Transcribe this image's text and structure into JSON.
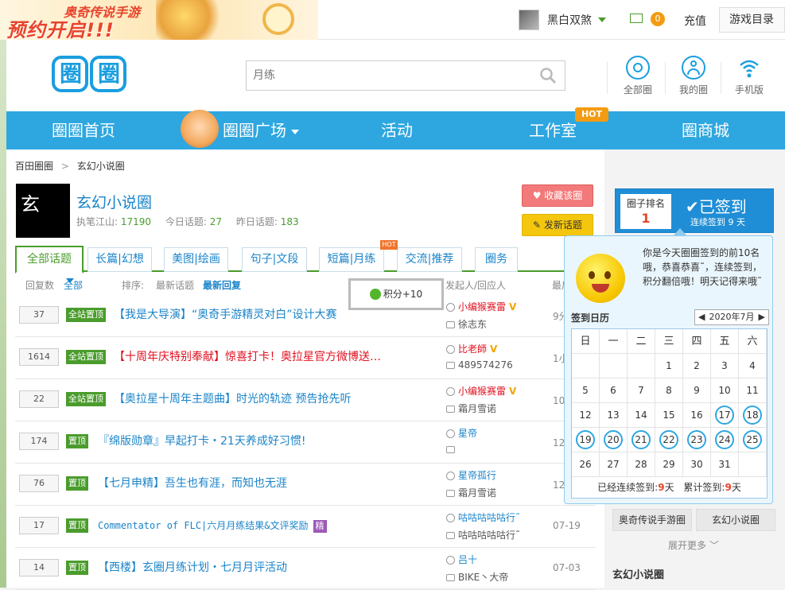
{
  "promo": {
    "line1": "奥奇传说手游",
    "line2": "预约开启!!!"
  },
  "user": {
    "name": "黑白双煞",
    "mail_count": "0",
    "recharge": "充值",
    "game_dir": "游戏目录"
  },
  "logo": {
    "chars": [
      "圈",
      "圈"
    ]
  },
  "search": {
    "placeholder": "月练"
  },
  "header_icons": [
    {
      "label": "全部圈",
      "icon": "all-circles-icon"
    },
    {
      "label": "我的圈",
      "icon": "user-icon"
    },
    {
      "label": "手机版",
      "icon": "wifi-icon"
    }
  ],
  "nav": {
    "home": "圈圈首页",
    "plaza": "圈圈广场",
    "events": "活动",
    "studio": "工作室",
    "studio_badge": "HOT",
    "mall": "圈商城"
  },
  "breadcrumb": {
    "root": "百田圈圈",
    "sep": ">",
    "current": "玄幻小说圈"
  },
  "circle": {
    "logo_char": "玄",
    "name": "玄幻小说圈",
    "master_label": "执笔江山:",
    "master_value": "17190",
    "today_label": "今日话题:",
    "today_value": "27",
    "yesterday_label": "昨日话题:",
    "yesterday_value": "183",
    "fav_button": "收藏该圈",
    "new_button": "发新话题"
  },
  "tabs": [
    {
      "label": "全部话题",
      "active": true
    },
    {
      "label": "长篇|幻想"
    },
    {
      "label": "美图|绘画"
    },
    {
      "label": "句子|文段"
    },
    {
      "label": "短篇|月练",
      "badge": "HOT"
    },
    {
      "label": "交流|推荐"
    },
    {
      "label": "圈务"
    }
  ],
  "filter": {
    "reply_count": "回复数",
    "all": "全部",
    "sort": "排序:",
    "latest_topic": "最新话题",
    "latest_reply": "最新回复",
    "author_col": "发起人/回应人",
    "time_col": "最后"
  },
  "toast": {
    "text": "积分+10"
  },
  "topics": [
    {
      "count": "37",
      "badge": "全站置顶",
      "title": "【我是大导演】“奥奇手游精灵对白”设计大赛",
      "red": false,
      "author": "小编猴赛雷",
      "author_red": true,
      "vip": "V",
      "replier": "徐志东",
      "time": "9分"
    },
    {
      "count": "1614",
      "badge": "全站置顶",
      "title": "【十周年庆特别奉献】惊喜打卡！奥拉星官方微博送…",
      "red": true,
      "author": "比老師",
      "author_red": true,
      "vip": "V",
      "replier": "489574276",
      "time": "1小"
    },
    {
      "count": "22",
      "badge": "全站置顶",
      "title": "【奥拉星十周年主题曲】时光的轨迹 预告抢先听",
      "red": false,
      "author": "小编猴赛雷",
      "author_red": true,
      "vip": "V",
      "replier": "霜月雪诺",
      "time": "10小"
    },
    {
      "count": "174",
      "badge": "置顶",
      "title": "『绵版勋章』早起打卡・21天养成好习惯!",
      "red": false,
      "author": "星帝",
      "author_red": false,
      "vip": "",
      "replier": "",
      "time": "12分"
    },
    {
      "count": "76",
      "badge": "置顶",
      "title": "【七月申精】吾生也有涯，而知也无涯",
      "red": false,
      "author": "星帝孤行",
      "author_red": false,
      "vip": "",
      "replier": "霜月雪诺",
      "time": "12小"
    },
    {
      "count": "17",
      "badge": "置顶",
      "title": "Commentator of FLC|六月月练结果&文评奖励",
      "red": false,
      "tag": "精",
      "author": "咕咕咕咕咕行˜",
      "author_red": false,
      "vip": "",
      "replier": "咕咕咕咕咕行˜",
      "time": "07-19"
    },
    {
      "count": "14",
      "badge": "置顶",
      "title": "【西楼】玄圈月练计划・七月月评活动",
      "red": false,
      "author": "吕十",
      "author_red": false,
      "vip": "",
      "replier": "BIKE丶大帝",
      "time": "07-03"
    }
  ],
  "rank": {
    "label": "圈子排名",
    "value": "1",
    "signed": "已签到",
    "streak": "连续签到 9 天"
  },
  "signin_popup": {
    "message": "你是今天圈圈签到的前10名哦，恭喜恭喜˜，连续签到，积分翻倍哦！明天记得来哦˜",
    "calendar_title": "签到日历",
    "month": "2020年7月",
    "weekdays": [
      "日",
      "一",
      "二",
      "三",
      "四",
      "五",
      "六"
    ],
    "weeks": [
      [
        "",
        "",
        "",
        "1",
        "2",
        "3",
        "4"
      ],
      [
        "5",
        "6",
        "7",
        "8",
        "9",
        "10",
        "11"
      ],
      [
        "12",
        "13",
        "14",
        "15",
        "16",
        "17",
        "18"
      ],
      [
        "19",
        "20",
        "21",
        "22",
        "23",
        "24",
        "25"
      ],
      [
        "26",
        "27",
        "28",
        "29",
        "30",
        "31",
        ""
      ]
    ],
    "signed_days": [
      "17",
      "18",
      "19",
      "20",
      "21",
      "22",
      "23",
      "24",
      "25"
    ],
    "footer_streak_label": "已经连续签到:",
    "footer_streak_value": "9",
    "footer_total_label": "累计签到:",
    "footer_total_value": "9",
    "day_unit": "天"
  },
  "sidebar": {
    "related": [
      "奥奇传说手游圈",
      "玄幻小说圈"
    ],
    "more": "展开更多",
    "section_title": "玄幻小说圈"
  },
  "colors": {
    "nav_blue": "#2ea7e0",
    "green": "#4a9c2c",
    "red": "#e0101f",
    "link_blue": "#1a84c9"
  }
}
